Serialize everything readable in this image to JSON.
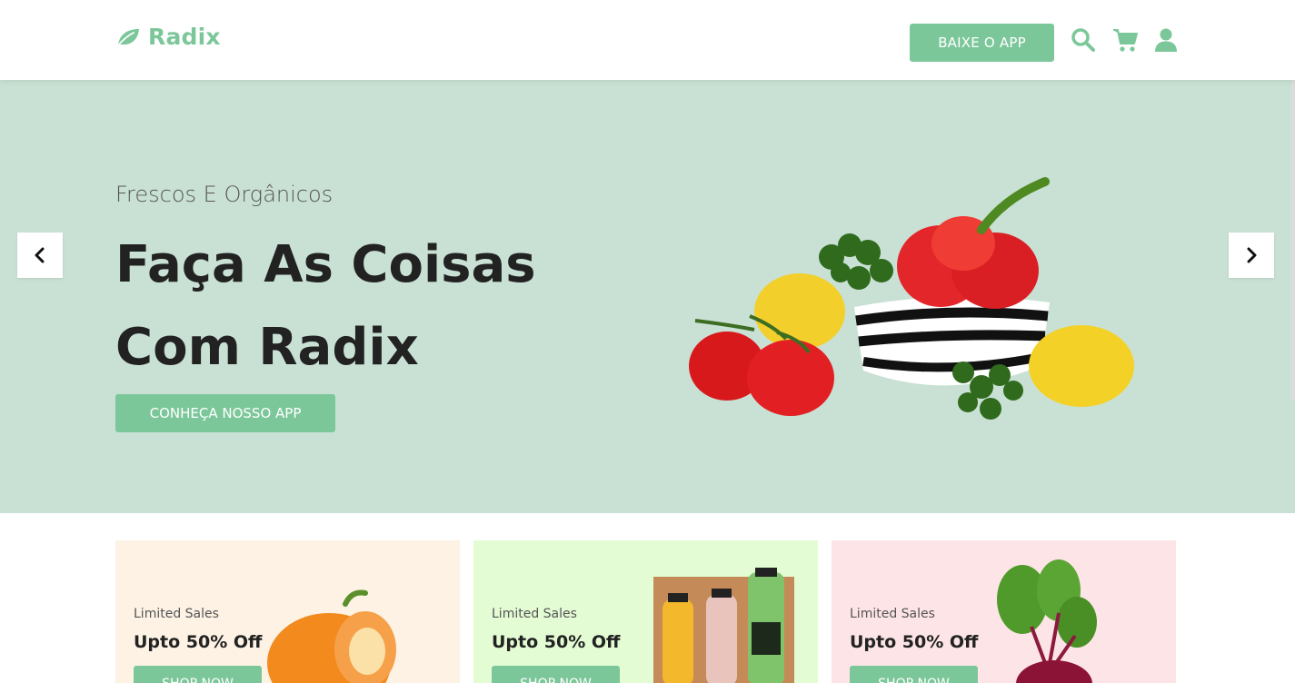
{
  "header": {
    "logo_text": "Radix",
    "app_button": "BAIXE O APP",
    "icons": [
      "search-icon",
      "cart-icon",
      "user-icon"
    ]
  },
  "hero": {
    "subtitle": "Frescos E Orgânicos",
    "title_line1": "Faça As Coisas",
    "title_line2": "Com Radix",
    "cta": "CONHEÇA NOSSO APP",
    "prev_icon": "chevron-left-icon",
    "next_icon": "chevron-right-icon"
  },
  "cards": [
    {
      "subtitle": "Limited Sales",
      "title": "Upto 50% Off",
      "button": "SHOP NOW",
      "bg": "#fdf2e4"
    },
    {
      "subtitle": "Limited Sales",
      "title": "Upto 50% Off",
      "button": "SHOP NOW",
      "bg": "#e3fcd4"
    },
    {
      "subtitle": "Limited Sales",
      "title": "Upto 50% Off",
      "button": "SHOP NOW",
      "bg": "#fde4e6"
    }
  ],
  "colors": {
    "accent": "#7cc79a",
    "hero_bg": "#c9e1d4",
    "text_dark": "#222222"
  }
}
